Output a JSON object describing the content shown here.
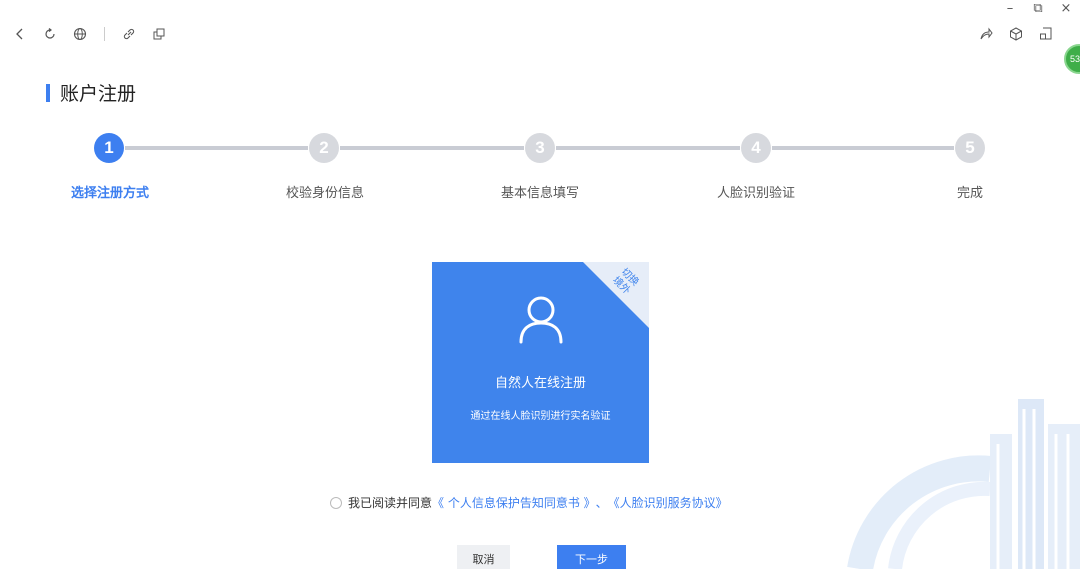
{
  "window": {
    "minimize": "–",
    "restore": "⧉",
    "close": "×"
  },
  "toolbar": {
    "left_icons": [
      "back-icon",
      "refresh-icon",
      "globe-icon",
      "link-icon",
      "copy-link-icon"
    ],
    "right_icons": [
      "share-icon",
      "cube-icon",
      "screenshot-icon"
    ],
    "badge": "53"
  },
  "page": {
    "title": "账户注册"
  },
  "steps": [
    {
      "num": "1",
      "label": "选择注册方式",
      "active": true
    },
    {
      "num": "2",
      "label": "校验身份信息",
      "active": false
    },
    {
      "num": "3",
      "label": "基本信息填写",
      "active": false
    },
    {
      "num": "4",
      "label": "人脸识别验证",
      "active": false
    },
    {
      "num": "5",
      "label": "完成",
      "active": false
    }
  ],
  "card": {
    "corner_line1": "切换",
    "corner_line2": "境外",
    "title": "自然人在线注册",
    "desc": "通过在线人脸识别进行实名验证",
    "icon": "person-icon"
  },
  "agreement": {
    "prefix": "我已阅读并同意",
    "link1": "《 个人信息保护告知同意书 》",
    "sep": "、",
    "link2": "《人脸识别服务协议》"
  },
  "buttons": {
    "cancel": "取消",
    "next": "下一步"
  },
  "colors": {
    "primary": "#3d7ff0",
    "card": "#3f84ec",
    "inactive_step": "#d7d9de"
  }
}
